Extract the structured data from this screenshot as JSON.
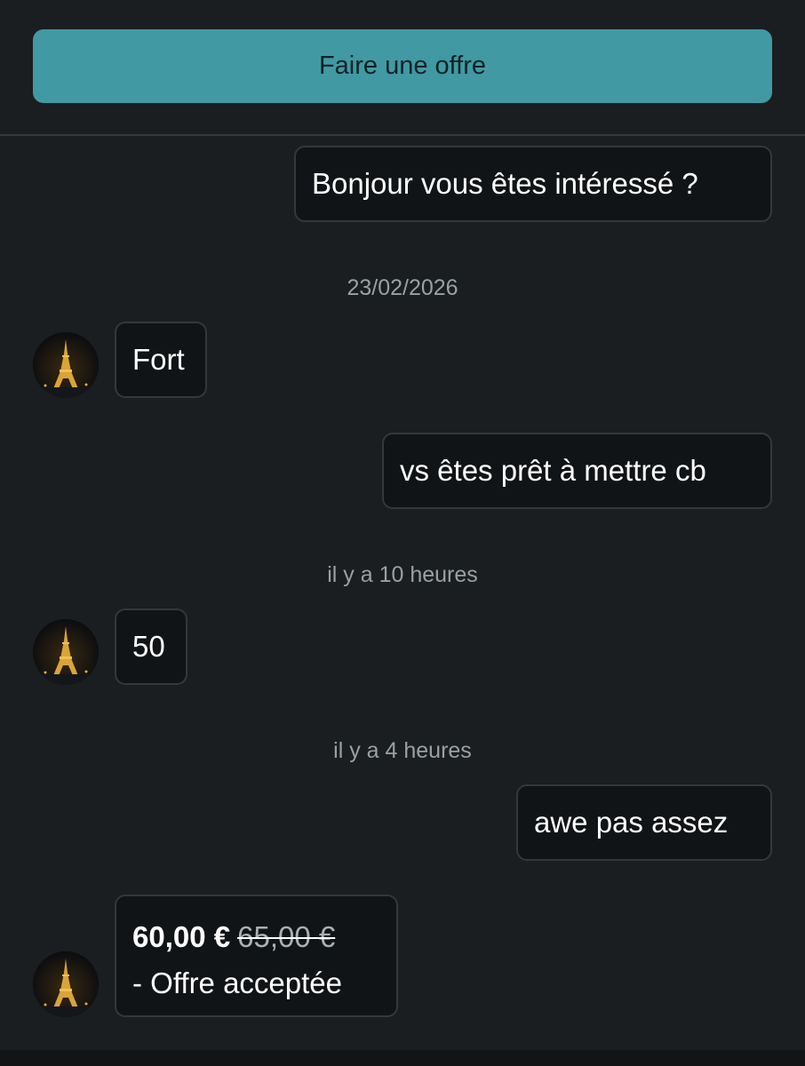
{
  "header": {
    "offer_button_label": "Faire une offre"
  },
  "messages": {
    "m1": "Bonjour vous êtes intéressé ?",
    "m2": "Fort",
    "m3": "vs êtes prêt à mettre cb",
    "m4": "50",
    "m5": "awe pas assez"
  },
  "timestamps": {
    "t1": "23/02/2026",
    "t2": "il y a 10 heures",
    "t3": "il y a 4 heures"
  },
  "offer": {
    "price": "60,00 €",
    "old_price": "65,00 €",
    "status": "- Offre acceptée"
  },
  "icons": {
    "avatar": "eiffel-tower-night-photo"
  },
  "colors": {
    "accent": "#4199a4",
    "background": "#1a1e20",
    "bubble": "#111416"
  }
}
